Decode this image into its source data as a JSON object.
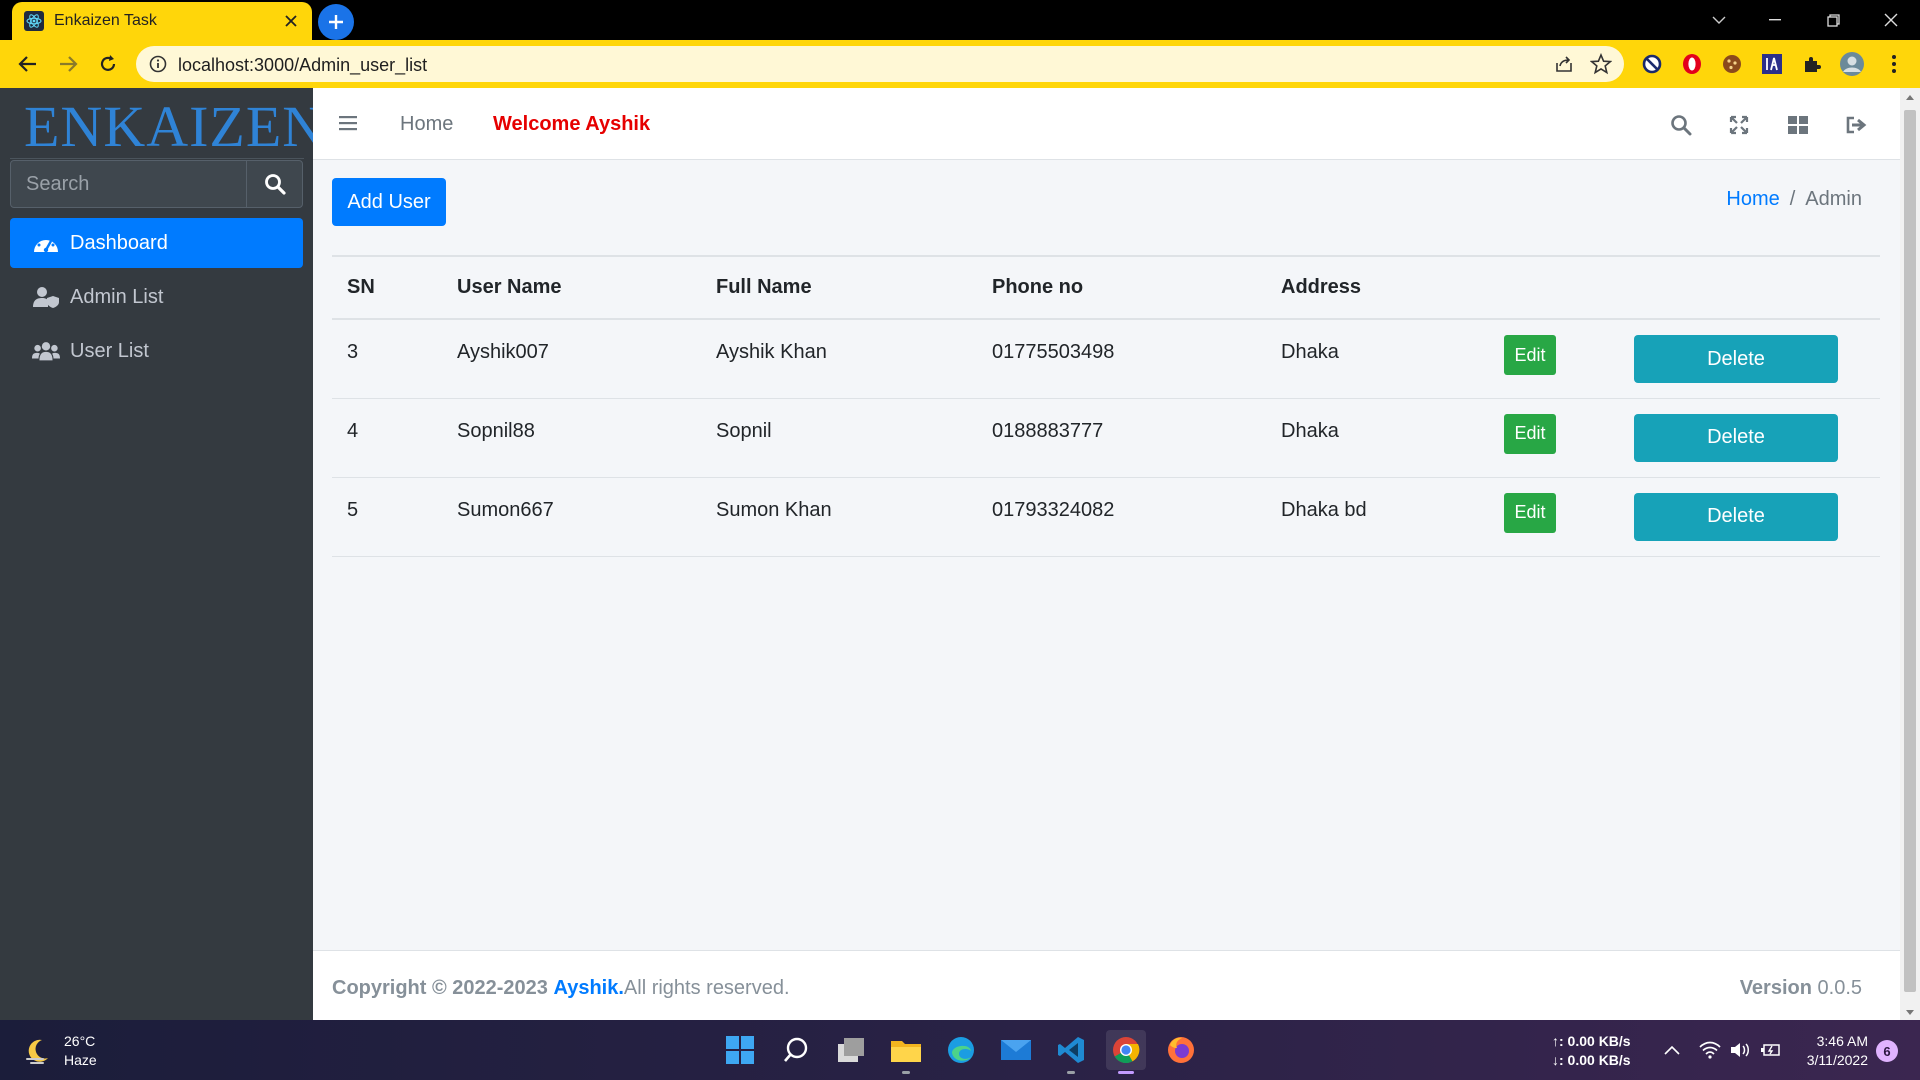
{
  "browser": {
    "tab_title": "Enkaizen Task",
    "url": "localhost:3000/Admin_user_list"
  },
  "sidebar": {
    "brand": "ENKAIZEN",
    "search_placeholder": "Search",
    "items": [
      {
        "label": "Dashboard",
        "icon": "dashboard-icon",
        "active": true
      },
      {
        "label": "Admin List",
        "icon": "user-shield-icon",
        "active": false
      },
      {
        "label": "User List",
        "icon": "users-icon",
        "active": false
      }
    ]
  },
  "header": {
    "home_link": "Home",
    "welcome": "Welcome Ayshik"
  },
  "toolbar": {
    "add_user_label": "Add User"
  },
  "breadcrumb": {
    "home": "Home",
    "separator": "/",
    "current": "Admin"
  },
  "table": {
    "columns": [
      "SN",
      "User Name",
      "Full Name",
      "Phone no",
      "Address"
    ],
    "rows": [
      {
        "sn": "3",
        "username": "Ayshik007",
        "fullname": "Ayshik Khan",
        "phone": "01775503498",
        "address": "Dhaka",
        "edit": "Edit",
        "delete": "Delete"
      },
      {
        "sn": "4",
        "username": "Sopnil88",
        "fullname": "Sopnil",
        "phone": "0188883777",
        "address": "Dhaka",
        "edit": "Edit",
        "delete": "Delete"
      },
      {
        "sn": "5",
        "username": "Sumon667",
        "fullname": "Sumon Khan",
        "phone": "01793324082",
        "address": "Dhaka bd",
        "edit": "Edit",
        "delete": "Delete"
      }
    ]
  },
  "footer": {
    "copyright_prefix": "Copyright © 2022-2023",
    "author": "Ayshik.",
    "rights": "All rights reserved.",
    "version_label": "Version",
    "version_value": "0.0.5"
  },
  "taskbar": {
    "temperature": "26°C",
    "weather": "Haze",
    "upload": "↑: 0.00 KB/s",
    "download": "↓: 0.00 KB/s",
    "time": "3:46 AM",
    "date": "3/11/2022",
    "notifications": "6"
  },
  "colors": {
    "primary": "#007bff",
    "success": "#28a745",
    "info": "#17a2b8",
    "sidebar_bg": "#343a40",
    "welcome": "#e60000",
    "browser_accent": "#ffd60a"
  }
}
